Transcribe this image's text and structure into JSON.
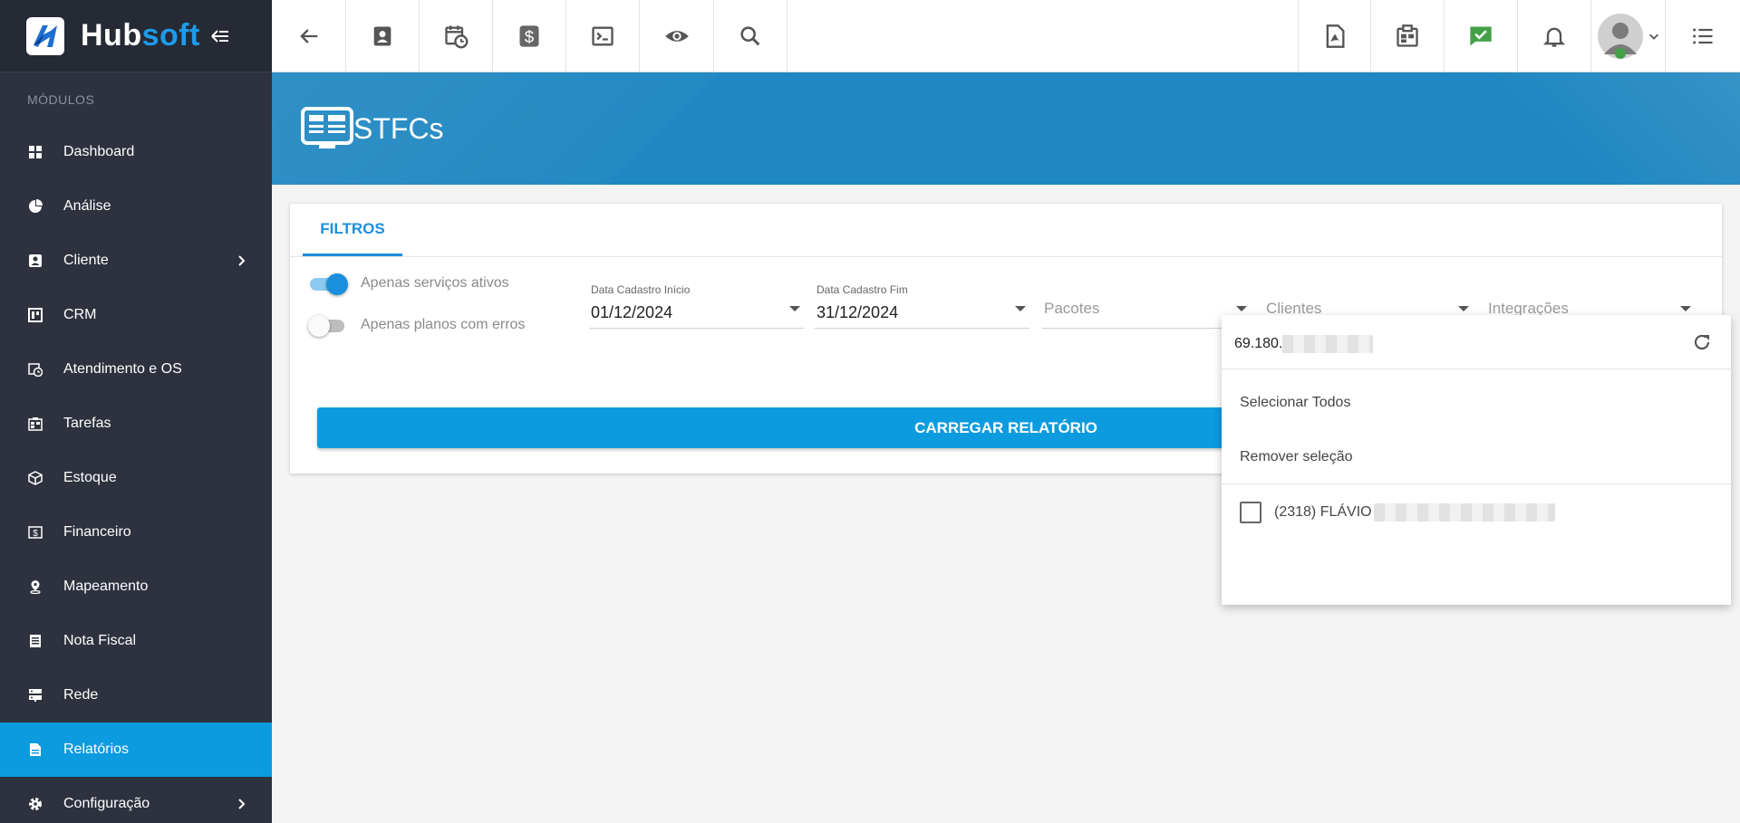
{
  "brand": {
    "name_part1": "Hub",
    "name_part2": "soft"
  },
  "sidebar": {
    "section_label": "MÓDULOS",
    "items": [
      {
        "label": "Dashboard",
        "icon": "dashboard-icon"
      },
      {
        "label": "Análise",
        "icon": "pie-chart-icon"
      },
      {
        "label": "Cliente",
        "icon": "contact-icon",
        "has_submenu": true
      },
      {
        "label": "CRM",
        "icon": "crm-icon"
      },
      {
        "label": "Atendimento e OS",
        "icon": "calendar-clock-icon"
      },
      {
        "label": "Tarefas",
        "icon": "tasks-icon"
      },
      {
        "label": "Estoque",
        "icon": "box-icon"
      },
      {
        "label": "Financeiro",
        "icon": "money-icon"
      },
      {
        "label": "Mapeamento",
        "icon": "map-pin-icon"
      },
      {
        "label": "Nota Fiscal",
        "icon": "invoice-icon"
      },
      {
        "label": "Rede",
        "icon": "server-icon"
      },
      {
        "label": "Relatórios",
        "icon": "report-icon",
        "active": true
      },
      {
        "label": "Configuração",
        "icon": "gear-icon",
        "has_submenu": true
      }
    ]
  },
  "header": {
    "title": "STFCs"
  },
  "tabs": [
    {
      "label": "FILTROS",
      "active": true
    }
  ],
  "filters": {
    "toggle_active_services": {
      "label": "Apenas serviços ativos",
      "on": true
    },
    "toggle_plans_errors": {
      "label": "Apenas planos com erros",
      "on": false
    },
    "date_start": {
      "label": "Data Cadastro Início",
      "value": "01/12/2024"
    },
    "date_end": {
      "label": "Data Cadastro Fim",
      "value": "31/12/2024"
    },
    "packages": {
      "placeholder": "Pacotes"
    },
    "clients": {
      "placeholder": "Clientes"
    },
    "integrations": {
      "placeholder": "Integrações"
    }
  },
  "load_button": "CARREGAR RELATÓRIO",
  "dropdown": {
    "search_value": "69.180.",
    "select_all": "Selecionar Todos",
    "remove_selection": "Remover seleção",
    "options": [
      {
        "label": "(2318) FLÁVIO",
        "checked": false
      }
    ]
  },
  "colors": {
    "sidebar_bg": "#2d323e",
    "accent": "#0d9be0",
    "header_band": "#1f87c1",
    "chat_green": "#43a047"
  }
}
